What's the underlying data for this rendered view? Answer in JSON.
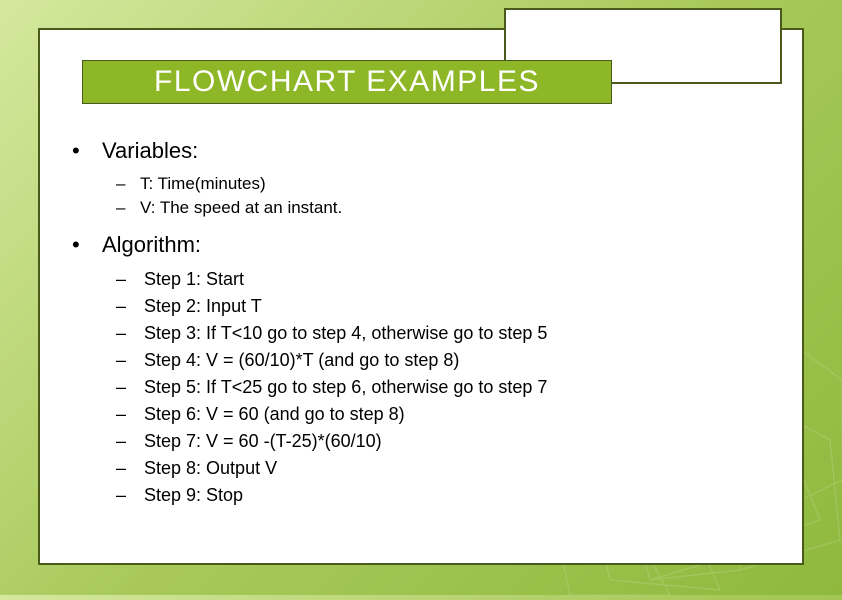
{
  "title": "FLOWCHART EXAMPLES",
  "sections": [
    {
      "heading": "Variables:",
      "items": [
        "T: Time(minutes)",
        "V: The speed at an instant."
      ]
    },
    {
      "heading": "Algorithm:",
      "items": [
        "Step 1: Start",
        "Step 2: Input T",
        "Step 3: If T<10 go to step 4, otherwise go to step 5",
        "Step 4: V = (60/10)*T (and go to step 8)",
        "Step 5: If T<25 go to step 6, otherwise go to step 7",
        "Step 6: V = 60  (and go to step 8)",
        "Step 7: V = 60 -(T-25)*(60/10)",
        "Step 8: Output V",
        "Step 9: Stop"
      ]
    }
  ]
}
